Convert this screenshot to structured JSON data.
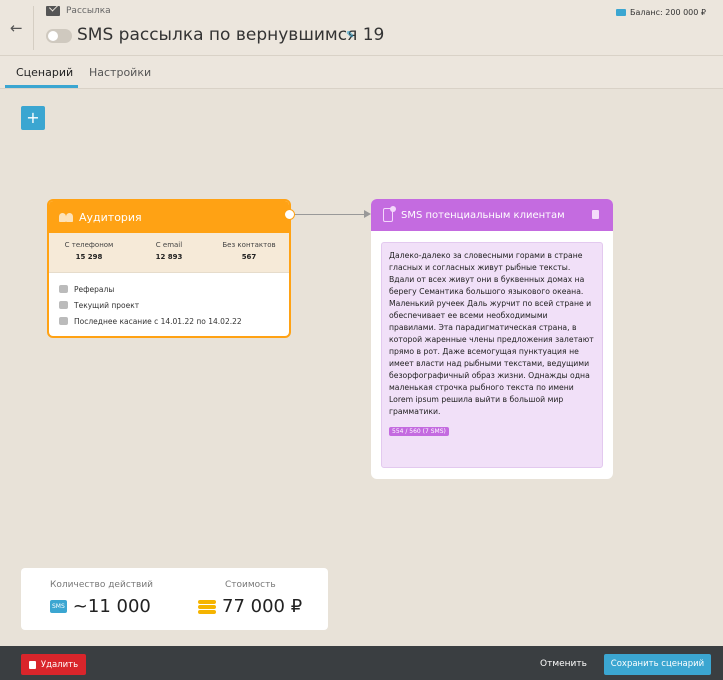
{
  "header": {
    "back_icon": "←",
    "breadcrumb": "Рассылка",
    "title": "SMS рассылка по вернувшимся 19",
    "balance": "Баланс: 200 000 ₽"
  },
  "tabs": [
    {
      "label": "Сценарий",
      "active": true
    },
    {
      "label": "Настройки",
      "active": false
    }
  ],
  "add_button_label": "+",
  "audience": {
    "title": "Аудитория",
    "stats": [
      {
        "label": "С телефоном",
        "value": "15 298"
      },
      {
        "label": "С email",
        "value": "12 893"
      },
      {
        "label": "Без контактов",
        "value": "567"
      }
    ],
    "filters": [
      "Рефералы",
      "Текущий проект",
      "Последнее касание  с 14.01.22  по 14.02.22"
    ]
  },
  "sms_card": {
    "title": "SMS потенциальным клиентам",
    "text": "Далеко-далеко за словесными горами в стране гласных и согласных живут рыбные тексты. Вдали от всех живут они в буквенных домах на берегу Семантика большого языкового океана. Маленький ручеек Даль журчит по всей стране и обеспечивает ее всеми необходимыми правилами. Эта парадигматическая страна, в которой жаренные члены предложения залетают прямо в рот. Даже всемогущая пунктуация не имеет власти над рыбными текстами, ведущими безорфографичный образ жизни. Однажды одна маленькая строчка рыбного текста по имени Lorem ipsum решила выйти в большой мир грамматики.",
    "counter": "554 / 560 (7 SMS)"
  },
  "summary": {
    "actions_label": "Количество действий",
    "actions_value": "~11 000",
    "sms_badge": "SMS",
    "cost_label": "Стоимость",
    "cost_value": "77 000 ₽"
  },
  "footer": {
    "delete_label": "Удалить",
    "cancel_label": "Отменить",
    "save_label": "Сохранить сценарий"
  },
  "colors": {
    "accent": "#3ba6d1",
    "audience": "#ffa214",
    "sms": "#c46be0",
    "danger": "#d9252b"
  }
}
